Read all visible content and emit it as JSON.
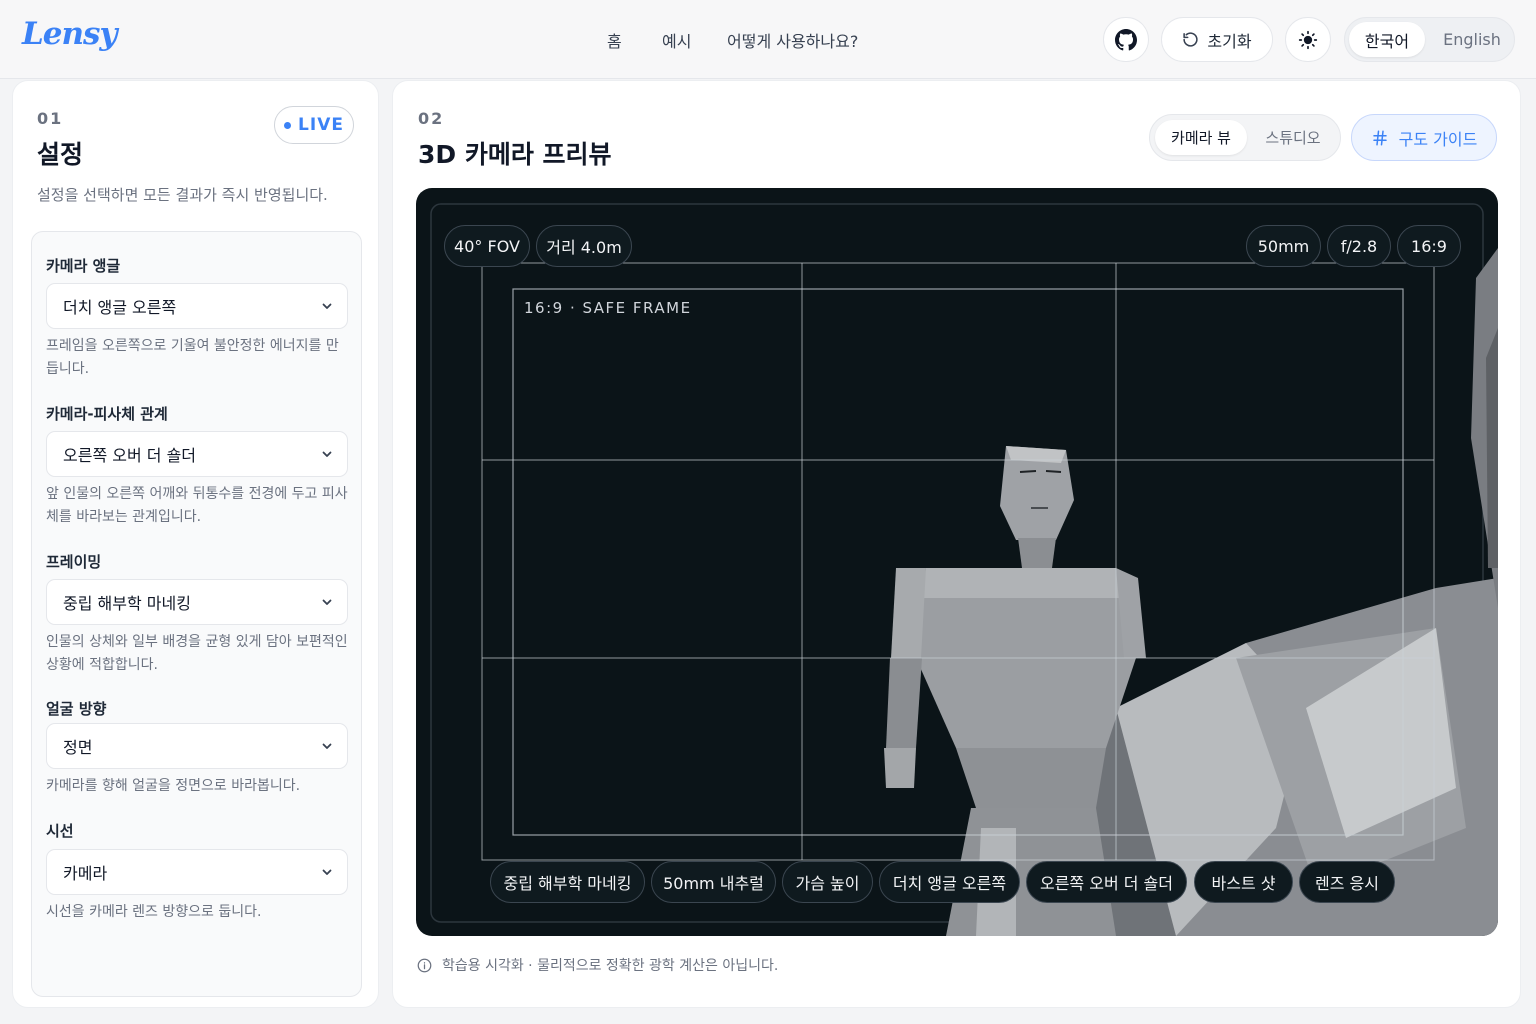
{
  "header": {
    "logo": "Lensy",
    "nav": [
      "홈",
      "예시",
      "어떻게 사용하나요?"
    ],
    "reset_label": "초기화",
    "languages": [
      "한국어",
      "English"
    ]
  },
  "settings": {
    "number": "01",
    "title": "설정",
    "live_label": "LIVE",
    "subtitle": "설정을 선택하면 모든 결과가 즉시 반영됩니다.",
    "fields": [
      {
        "label": "카메라 앵글",
        "value": "더치 앵글 오른쪽",
        "hint": "프레임을 오른쪽으로 기울여 불안정한 에너지를 만듭니다."
      },
      {
        "label": "카메라-피사체 관계",
        "value": "오른쪽 오버 더 숄더",
        "hint": "앞 인물의 오른쪽 어깨와 뒤통수를 전경에 두고 피사체를 바라보는 관계입니다."
      },
      {
        "label": "프레이밍",
        "value": "중립 해부학 마네킹",
        "hint": "인물의 상체와 일부 배경을 균형 있게 담아 보편적인 상황에 적합합니다."
      },
      {
        "label": "얼굴 방향",
        "value": "정면",
        "hint": "카메라를 향해 얼굴을 정면으로 바라봅니다."
      },
      {
        "label": "시선",
        "value": "카메라",
        "hint": "시선을 카메라 렌즈 방향으로 둡니다."
      }
    ]
  },
  "preview": {
    "number": "02",
    "title": "3D 카메라 프리뷰",
    "view_options": [
      "카메라 뷰",
      "스튜디오"
    ],
    "guide_label": "구도 가이드",
    "top_left_chips": [
      "40° FOV",
      "거리 4.0m"
    ],
    "top_right_chips": [
      "50mm",
      "f/2.8",
      "16:9"
    ],
    "safe_frame_label": "16:9 · SAFE FRAME",
    "bottom_chips": [
      "중립 해부학 마네킹",
      "50mm 내추럴",
      "가슴 높이",
      "더치 앵글 오른쪽",
      "오른쪽 오버 더 숄더",
      "바스트 샷",
      "렌즈 응시"
    ],
    "footnote": "학습용 시각화 · 물리적으로 정확한 광학 계산은 아닙니다."
  }
}
